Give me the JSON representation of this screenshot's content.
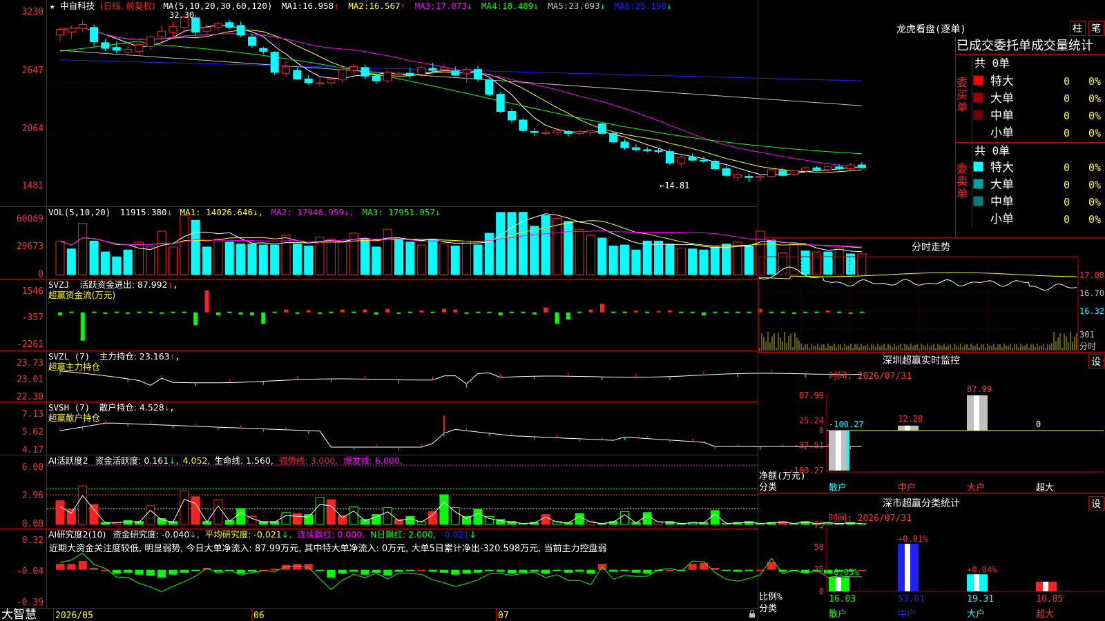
{
  "colors": {
    "up": "#ff2020",
    "down": "#00ffff",
    "frame": "#c00000",
    "bg": "#000000",
    "ma1": "#ffffff",
    "ma2": "#ffff00",
    "ma3": "#ff00ff",
    "ma4": "#00ff00",
    "ma5": "#c0c0c0",
    "ma6": "#2020ff",
    "green": "#00ff00",
    "yellow": "#ffff00",
    "magenta": "#ff00ff"
  },
  "app": {
    "brand": "大智慧"
  },
  "main": {
    "title_star": "★",
    "stock": "中自科技",
    "mode": "(日线, 前复权)",
    "ma_label": "MA(5,10,20,30,60,120)",
    "ma": [
      {
        "label": "MA1:",
        "value": "16.958",
        "arrow": "↑"
      },
      {
        "label": "MA2:",
        "value": "16.567",
        "arrow": "↑"
      },
      {
        "label": "MA3:",
        "value": "17.073",
        "arrow": "↓"
      },
      {
        "label": "MA4:",
        "value": "18.489",
        "arrow": "↓"
      },
      {
        "label": "MA5:",
        "value": "23.093",
        "arrow": "↓"
      },
      {
        "label": "MA6:",
        "value": "25.190",
        "arrow": "↓"
      }
    ],
    "y_ticks": [
      "3230",
      "2647",
      "2064",
      "1481"
    ],
    "high_mark": "32.30",
    "low_mark": "←14.81"
  },
  "vol": {
    "label": "VOL(5,10,20)",
    "value": "11915.380",
    "arrow": "↓",
    "ma1": "MA1: 14026.646↓,",
    "ma2": "MA2: 17946.959↓,",
    "ma3": "MA3: 17951.057↓",
    "y_ticks": [
      "60089",
      "29673",
      "0"
    ]
  },
  "svzj": {
    "label": "SVZJ",
    "item": "活跃资金进出: 87.992",
    "arrow": "↑",
    "sub": "超赢资金流(万元)",
    "y_ticks": [
      "1546",
      "-357",
      "-2261"
    ]
  },
  "svzl": {
    "label": "SVZL (7)",
    "item": "主力持仓: 23.163",
    "arrow": "↑",
    "sub": "超赢主力持仓",
    "y_ticks": [
      "23.73",
      "23.01",
      "22.30"
    ]
  },
  "svsh": {
    "label": "SVSH (7)",
    "item": "散户持仓: 4.528",
    "arrow": "↓",
    "sub": "超赢散户持仓",
    "y_ticks": [
      "7.13",
      "5.62",
      "4.17"
    ]
  },
  "ai1": {
    "label": "AI活跃度2",
    "item": "资金活跃度: 0.161",
    "arrow": "↓",
    "v2": "4.052,",
    "life": "生命线: 1.560,",
    "strong": "强势线: 3.000,",
    "burst": "爆发线: 6.000,",
    "y_ticks": [
      "6.00",
      "2.96",
      "0.00"
    ]
  },
  "ai2": {
    "label": "AI研究度2(10)",
    "item": "资金研究度: -0.040",
    "arrow": "↓",
    "avg": "平均研究度: -0.021",
    "cont": "连续飘红: 0.000,",
    "n": "N日飘红: 2.000,",
    "last": "-0.021",
    "desc": "近期大资金关注度较低, 明显弱势, 今日大单净流入: 87.99万元, 其中特大单净流入: 0万元, 大单5日累计净出-320.598万元, 当前主力控盘弱",
    "y_ticks": [
      "0.32",
      "-0.04",
      "-0.39"
    ]
  },
  "xaxis": {
    "labels": [
      "2026/05",
      "06",
      "07"
    ]
  },
  "right": {
    "lhb_title": "龙虎看盘(逐单)",
    "btn_zhu": "柱",
    "btn_bi": "笔",
    "stats_title": "已成交委托单成交量统计",
    "buy_side": "委买单",
    "sell_side": "委卖单",
    "buy_total": "共 0单",
    "sell_total": "共 0单",
    "buy_rows": [
      {
        "name": "特大",
        "v": "0",
        "p": "0%",
        "c": "#ff0000"
      },
      {
        "name": "大单",
        "v": "0",
        "p": "0%",
        "c": "#a00000"
      },
      {
        "name": "中单",
        "v": "0",
        "p": "0%",
        "c": "#700000"
      },
      {
        "name": "小单",
        "v": "0",
        "p": "0%",
        "c": "#000000"
      }
    ],
    "sell_rows": [
      {
        "name": "特大",
        "v": "0",
        "p": "0%",
        "c": "#00ffff"
      },
      {
        "name": "大单",
        "v": "0",
        "p": "0%",
        "c": "#00a0a0"
      },
      {
        "name": "中单",
        "v": "0",
        "p": "0%",
        "c": "#008080"
      },
      {
        "name": "小单",
        "v": "0",
        "p": "0%",
        "c": "#000000"
      }
    ],
    "fenshi_title": "分时走势",
    "fenshi_ticks": [
      "17.08",
      "16.70",
      "16.32"
    ],
    "fenshi_vol": "301",
    "fenshi_unit": "分时",
    "monitor_title": "深圳超赢实时监控",
    "set1": "设",
    "time1": "时间: 2026/07/31",
    "mon_ticks": [
      "87.99",
      "25.24",
      "0",
      "-37.51",
      "-100.27"
    ],
    "mon_labels": [
      "-100.27",
      "12.28",
      "87.99",
      "0"
    ],
    "mon_cats": [
      "散户",
      "中户",
      "大户",
      "超大"
    ],
    "net_label": "净额(万元)",
    "cat_label": "分类",
    "class_title": "深市超赢分类统计",
    "set2": "设",
    "time2": "时间: 2026/07/31",
    "cls_ticks": [
      "75",
      "50",
      "25",
      "0"
    ],
    "cls_top": [
      "-0.05%",
      "+0.01%",
      "+0.04%",
      ""
    ],
    "cls_bottom": [
      "16.03",
      "53.81",
      "19.31",
      "10.85"
    ],
    "ratio_label": "比例%",
    "cat_label2": "分类"
  },
  "chart_data": [
    {
      "type": "candlestick",
      "name": "price",
      "ylim": [
        14.0,
        33.0
      ],
      "ohlc": [
        [
          30.2,
          31.0,
          29.5,
          30.8
        ],
        [
          30.5,
          31.2,
          29.8,
          30.9
        ],
        [
          30.9,
          31.8,
          30.5,
          31.3
        ],
        [
          31.0,
          31.3,
          29.0,
          29.5
        ],
        [
          29.4,
          29.8,
          28.5,
          28.8
        ],
        [
          28.9,
          29.5,
          28.3,
          28.6
        ],
        [
          28.4,
          29.0,
          28.0,
          28.7
        ],
        [
          28.5,
          29.4,
          28.0,
          29.2
        ],
        [
          29.0,
          30.2,
          28.6,
          30.0
        ],
        [
          30.0,
          31.2,
          29.5,
          30.6
        ],
        [
          30.5,
          31.6,
          29.9,
          31.1
        ],
        [
          31.0,
          32.3,
          30.5,
          32.1
        ],
        [
          32.0,
          32.3,
          30.0,
          30.5
        ],
        [
          30.6,
          31.4,
          30.0,
          31.0
        ],
        [
          31.0,
          31.6,
          30.5,
          31.4
        ],
        [
          31.5,
          31.8,
          30.8,
          31.0
        ],
        [
          31.2,
          31.6,
          30.0,
          30.2
        ],
        [
          30.0,
          30.3,
          28.8,
          29.1
        ],
        [
          28.8,
          29.0,
          28.2,
          28.5
        ],
        [
          28.4,
          28.5,
          26.0,
          26.3
        ],
        [
          26.2,
          27.5,
          25.8,
          26.9
        ],
        [
          26.5,
          26.8,
          25.5,
          25.6
        ],
        [
          25.6,
          26.0,
          25.0,
          25.2
        ],
        [
          25.1,
          25.7,
          24.8,
          25.2
        ],
        [
          25.2,
          25.9,
          24.9,
          25.6
        ],
        [
          25.5,
          26.8,
          25.2,
          26.6
        ],
        [
          26.5,
          27.2,
          26.0,
          26.9
        ],
        [
          26.8,
          27.1,
          25.6,
          25.9
        ],
        [
          25.9,
          26.2,
          25.1,
          25.4
        ],
        [
          25.4,
          26.6,
          25.2,
          26.3
        ],
        [
          26.2,
          26.4,
          25.8,
          26.2
        ],
        [
          26.2,
          26.8,
          25.6,
          26.0
        ],
        [
          26.1,
          27.0,
          25.8,
          26.8
        ],
        [
          26.7,
          27.3,
          26.4,
          26.5
        ],
        [
          26.6,
          27.2,
          26.3,
          26.8
        ],
        [
          26.4,
          26.9,
          25.9,
          26.0
        ],
        [
          26.2,
          26.8,
          25.2,
          26.6
        ],
        [
          26.6,
          27.0,
          25.3,
          25.6
        ],
        [
          25.5,
          25.7,
          23.8,
          24.0
        ],
        [
          24.0,
          24.2,
          22.0,
          22.2
        ],
        [
          22.2,
          22.5,
          21.0,
          21.3
        ],
        [
          21.3,
          21.5,
          20.0,
          20.2
        ],
        [
          20.1,
          20.4,
          19.6,
          20.0
        ],
        [
          20.0,
          20.3,
          19.7,
          20.0
        ],
        [
          20.0,
          20.5,
          19.8,
          20.2
        ],
        [
          20.1,
          20.3,
          19.6,
          19.9
        ],
        [
          19.9,
          20.3,
          19.7,
          20.1
        ],
        [
          20.0,
          20.3,
          19.6,
          20.2
        ],
        [
          20.9,
          21.0,
          19.8,
          19.9
        ],
        [
          19.9,
          20.1,
          18.9,
          19.0
        ],
        [
          19.0,
          19.3,
          18.2,
          18.4
        ],
        [
          18.4,
          18.8,
          18.0,
          18.2
        ],
        [
          18.2,
          18.5,
          17.9,
          18.1
        ],
        [
          18.1,
          18.4,
          17.8,
          18.0
        ],
        [
          18.0,
          18.3,
          16.6,
          16.8
        ],
        [
          16.8,
          17.6,
          16.4,
          17.4
        ],
        [
          17.4,
          17.8,
          17.0,
          17.1
        ],
        [
          17.1,
          17.5,
          16.8,
          17.0
        ],
        [
          17.0,
          17.2,
          16.0,
          16.2
        ],
        [
          16.2,
          16.5,
          15.3,
          15.5
        ],
        [
          15.3,
          15.8,
          14.9,
          15.6
        ],
        [
          15.4,
          15.7,
          14.81,
          15.3
        ],
        [
          15.3,
          15.6,
          14.9,
          15.4
        ],
        [
          15.4,
          16.2,
          15.2,
          16.1
        ],
        [
          16.0,
          16.3,
          15.4,
          15.5
        ],
        [
          15.6,
          16.1,
          15.4,
          16.0
        ],
        [
          16.0,
          16.4,
          15.8,
          16.3
        ],
        [
          16.3,
          16.5,
          15.9,
          16.1
        ],
        [
          16.1,
          16.5,
          15.9,
          16.4
        ],
        [
          16.4,
          16.7,
          16.0,
          16.2
        ],
        [
          16.2,
          16.8,
          15.9,
          16.6
        ],
        [
          16.6,
          16.9,
          16.2,
          16.3
        ]
      ],
      "high": 32.3,
      "low": 14.81
    },
    {
      "type": "bar",
      "name": "volume",
      "ylim": [
        0,
        60089
      ],
      "values": [
        34000,
        26000,
        52000,
        34000,
        23000,
        18000,
        25000,
        33000,
        28000,
        44000,
        28000,
        60089,
        55000,
        28000,
        36000,
        33000,
        31000,
        31000,
        30000,
        30000,
        40000,
        31000,
        29000,
        38000,
        36000,
        33000,
        42000,
        36000,
        28000,
        46000,
        35000,
        33000,
        30000,
        36000,
        31000,
        29000,
        34000,
        30000,
        42000,
        63000,
        70000,
        66000,
        49000,
        60000,
        57000,
        54000,
        46000,
        40000,
        37000,
        29000,
        30000,
        25000,
        34000,
        34000,
        31000,
        27000,
        26000,
        25000,
        28000,
        31000,
        33000,
        29000,
        44000,
        35000,
        22000,
        31000,
        24000,
        23000,
        23000,
        28000,
        21000,
        21000
      ],
      "up": [
        1,
        0,
        1,
        0,
        0,
        0,
        0,
        1,
        1,
        1,
        1,
        1,
        0,
        0,
        1,
        0,
        0,
        0,
        0,
        0,
        1,
        0,
        0,
        1,
        1,
        1,
        1,
        0,
        0,
        1,
        0,
        0,
        1,
        0,
        1,
        0,
        1,
        0,
        0,
        0,
        0,
        0,
        0,
        0,
        1,
        0,
        1,
        1,
        0,
        0,
        0,
        0,
        0,
        0,
        0,
        1,
        0,
        0,
        0,
        0,
        1,
        0,
        1,
        0,
        1,
        1,
        0,
        1,
        0,
        1,
        0,
        1
      ]
    },
    {
      "type": "bar",
      "name": "svzj",
      "ylim": [
        -2261,
        1546
      ],
      "values": [
        -200,
        0,
        -2000,
        0,
        -100,
        0,
        -80,
        0,
        0,
        -100,
        0,
        0,
        -900,
        1546,
        -200,
        0,
        -150,
        -200,
        -800,
        0,
        200,
        -100,
        150,
        -100,
        0,
        200,
        0,
        200,
        -150,
        250,
        -80,
        0,
        120,
        0,
        250,
        200,
        -100,
        0,
        0,
        -200,
        0,
        0,
        -150,
        350,
        -800,
        -500,
        0,
        200,
        600,
        0,
        0,
        120,
        0,
        100,
        150,
        0,
        0,
        -200,
        0,
        0,
        0,
        0,
        250,
        0,
        0,
        -100,
        0,
        0,
        150,
        0,
        -80,
        0,
        0
      ]
    },
    {
      "type": "line",
      "name": "svzl",
      "ylim": [
        22.3,
        23.73
      ]
    },
    {
      "type": "line",
      "name": "svsh",
      "ylim": [
        4.17,
        7.13
      ]
    },
    {
      "type": "bar",
      "name": "ai1",
      "ylim": [
        0,
        6.0
      ],
      "lines": {
        "burst": 6.0,
        "strong": 3.0,
        "life": 1.56
      }
    },
    {
      "type": "bar",
      "name": "ai2",
      "ylim": [
        -0.39,
        0.32
      ]
    },
    {
      "type": "bar",
      "name": "mon",
      "categories": [
        "散户",
        "中户",
        "大户",
        "超大"
      ],
      "values": [
        -100.27,
        12.28,
        87.99,
        0
      ],
      "ylim": [
        -100.27,
        87.99
      ]
    },
    {
      "type": "bar",
      "name": "cls",
      "categories": [
        "散户",
        "中户",
        "大户",
        "超大"
      ],
      "values": [
        16.03,
        53.81,
        19.31,
        10.85
      ],
      "ylim": [
        0,
        75
      ],
      "colors": [
        "#00ff00",
        "#2020ff",
        "#00ffff",
        "#ff2020"
      ]
    }
  ]
}
